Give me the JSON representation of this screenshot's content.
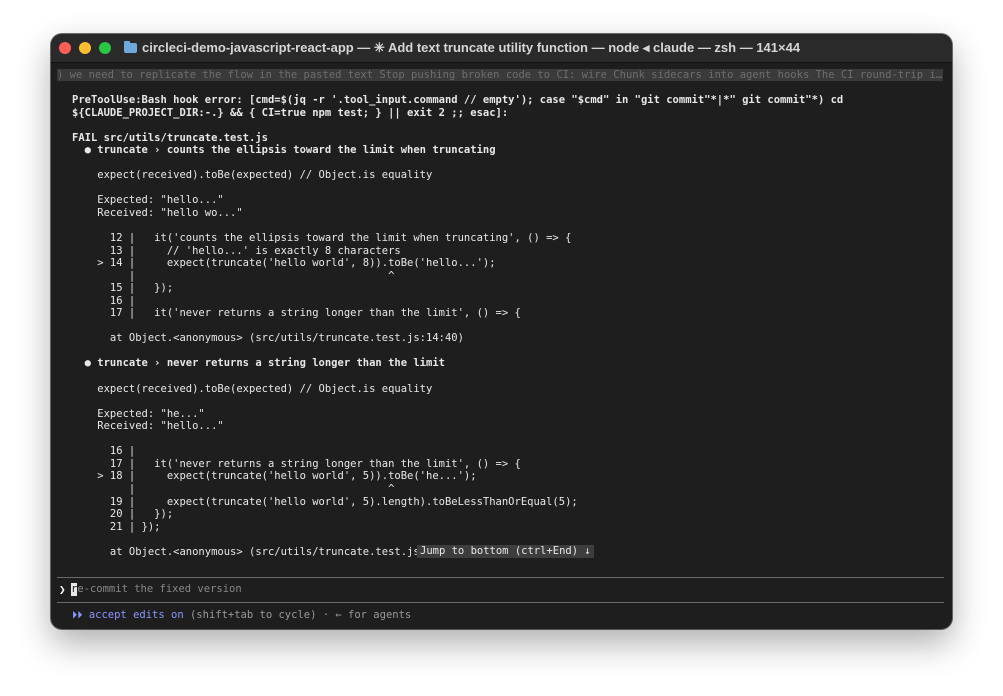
{
  "window": {
    "title": "circleci-demo-javascript-react-app — ✳ Add text truncate utility function — node ◂ claude — zsh — 141×44"
  },
  "icons": {
    "folder": "folder-icon"
  },
  "colors": {
    "background": "#1e1e1e",
    "titlebar": "#2a2a2a",
    "text": "#e8e8e8",
    "accent": "#8a96ff",
    "close": "#ff5f57",
    "minimize": "#febc2e",
    "maximize": "#28c840"
  },
  "banner": {
    "text": ") we need to replicate the flow in the pasted text Stop pushing broken code to CI: wire Chunk sidecars into agent hooks The CI round-trip i…"
  },
  "hook_error": {
    "line1": "PreToolUse:Bash hook error: [cmd=$(jq -r '.tool_input.command // empty'); case \"$cmd\" in \"git commit\"*|*\" git commit\"*) cd",
    "line2": "${CLAUDE_PROJECT_DIR:-.} && { CI=true npm test; } || exit 2 ;; esac]:"
  },
  "test_output": {
    "fail_line": "FAIL src/utils/truncate.test.js",
    "failure1": {
      "header": "  ● truncate › counts the ellipsis toward the limit when truncating",
      "expect_line": "    expect(received).toBe(expected) // Object.is equality",
      "expected": "    Expected: \"hello...\"",
      "received": "    Received: \"hello wo...\"",
      "code": [
        "      12 |   it('counts the ellipsis toward the limit when truncating', () => {",
        "      13 |     // 'hello...' is exactly 8 characters",
        "    > 14 |     expect(truncate('hello world', 8)).toBe('hello...');",
        "         |                                        ^",
        "      15 |   });",
        "      16 |",
        "      17 |   it('never returns a string longer than the limit', () => {"
      ],
      "location": "      at Object.<anonymous> (src/utils/truncate.test.js:14:40)"
    },
    "failure2": {
      "header": "  ● truncate › never returns a string longer than the limit",
      "expect_line": "    expect(received).toBe(expected) // Object.is equality",
      "expected": "    Expected: \"he...\"",
      "received": "    Received: \"hello...\"",
      "code": [
        "      16 |",
        "      17 |   it('never returns a string longer than the limit', () => {",
        "    > 18 |     expect(truncate('hello world', 5)).toBe('he...');",
        "         |                                        ^",
        "      19 |     expect(truncate('hello world', 5).length).toBeLessThanOrEqual(5);",
        "      20 |   });",
        "      21 | });"
      ],
      "location": "      at Object.<anonymous> (src/utils/truncate.test.js"
    }
  },
  "jump_button": {
    "label": "Jump to bottom (ctrl+End) ↓"
  },
  "prompt": {
    "glyph": "❯",
    "cursor_char": "r",
    "text_rest": "e-commit the fixed version"
  },
  "status": {
    "arrows": "⏵⏵",
    "mode": "accept edits on",
    "hint": "(shift+tab to cycle) · ← for agents"
  }
}
